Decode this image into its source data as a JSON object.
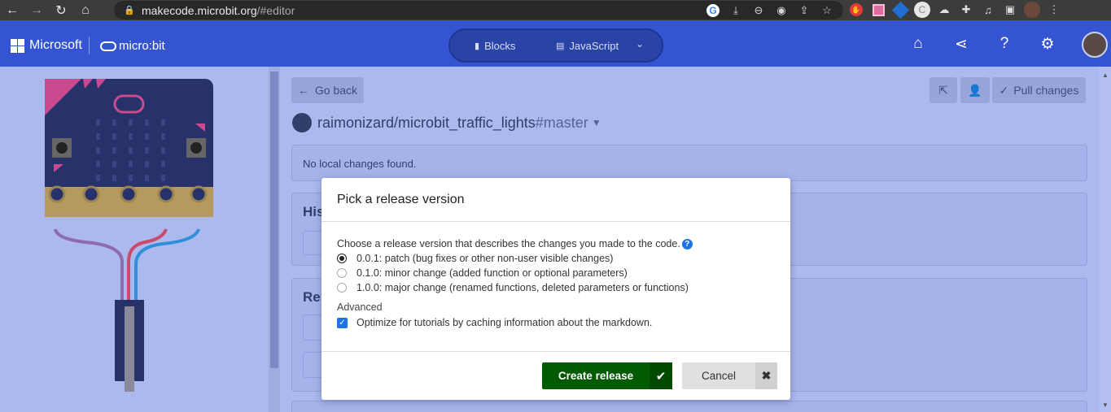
{
  "browser": {
    "url_host": "makecode.microbit.org",
    "url_path": "/#editor"
  },
  "header": {
    "brand": "Microsoft",
    "product": "micro:bit",
    "tabs": [
      {
        "label": "Blocks"
      },
      {
        "label": "JavaScript"
      }
    ]
  },
  "github": {
    "go_back": "Go back",
    "pull_changes": "Pull changes",
    "repo": "raimonizard/microbit_traffic_lights",
    "branch": "#master",
    "status": "No local changes found.",
    "history_title": "His",
    "release_title": "Rel"
  },
  "modal": {
    "title": "Pick a release version",
    "description": "Choose a release version that describes the changes you made to the code.",
    "options": [
      {
        "label": "0.0.1: patch (bug fixes or other non-user visible changes)",
        "selected": true
      },
      {
        "label": "0.1.0: minor change (added function or optional parameters)",
        "selected": false
      },
      {
        "label": "1.0.0: major change (renamed functions, deleted parameters or functions)",
        "selected": false
      }
    ],
    "advanced_label": "Advanced",
    "optimize_label": "Optimize for tutorials by caching information about the markdown.",
    "optimize_checked": true,
    "create_label": "Create release",
    "cancel_label": "Cancel"
  },
  "colors": {
    "header_blue": "#3454d1",
    "create_green": "#005a00",
    "sim_background": "#acb9ee"
  }
}
